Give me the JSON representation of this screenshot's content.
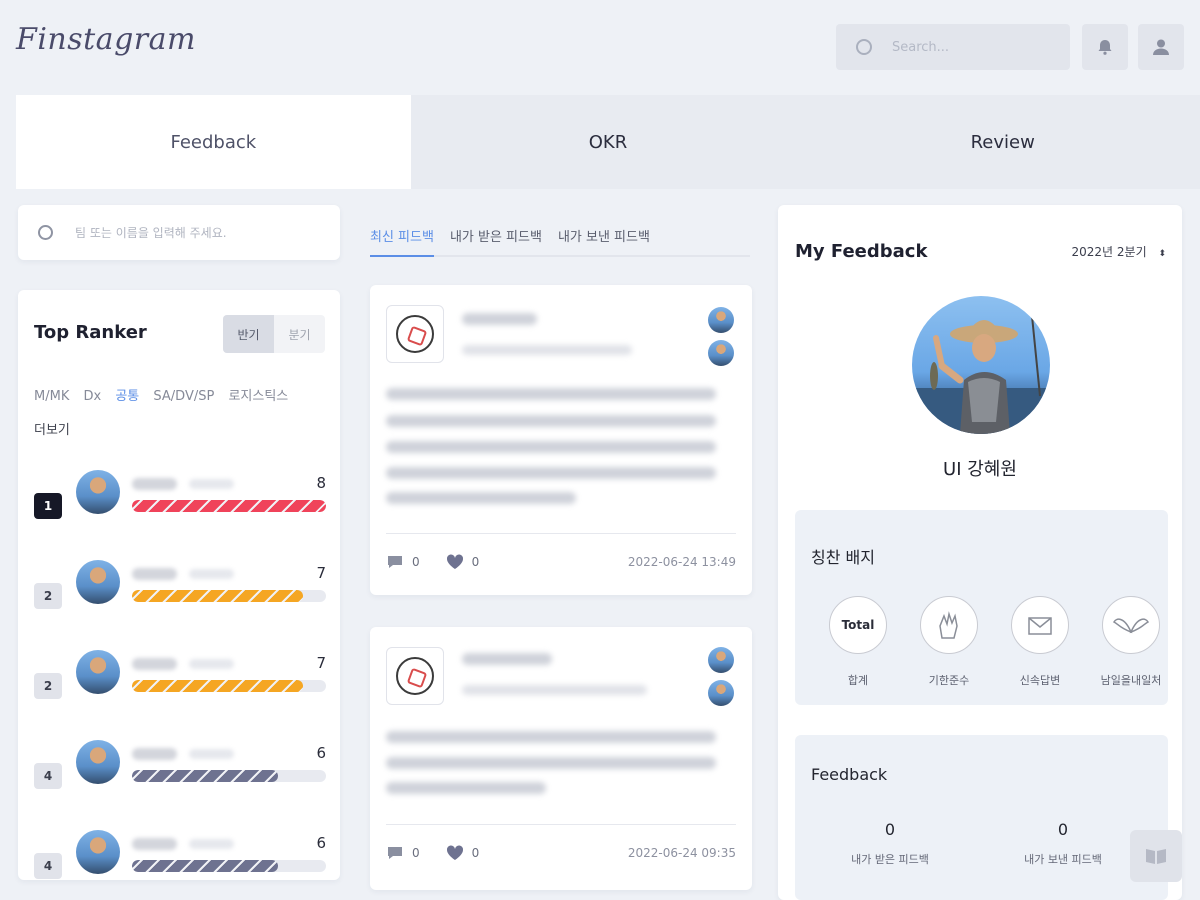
{
  "header": {
    "logo": "Finstagram",
    "search_placeholder": "Search..."
  },
  "tabs": [
    {
      "label": "Feedback",
      "active": true
    },
    {
      "label": "OKR",
      "active": false
    },
    {
      "label": "Review",
      "active": false
    }
  ],
  "left": {
    "search_placeholder": "팀 또는 이름을 입력해 주세요.",
    "ranker": {
      "title": "Top Ranker",
      "toggle": [
        "반기",
        "분기"
      ],
      "filters": [
        "M/MK",
        "Dx",
        "공통",
        "SA/DV/SP",
        "로지스틱스"
      ],
      "selected_filter": "공통",
      "more": "더보기",
      "rows": [
        {
          "rank": "1",
          "score": "8",
          "fill": 1.0,
          "color": "#f0435a"
        },
        {
          "rank": "2",
          "score": "7",
          "fill": 0.88,
          "color": "#f5a623"
        },
        {
          "rank": "2",
          "score": "7",
          "fill": 0.88,
          "color": "#f5a623"
        },
        {
          "rank": "4",
          "score": "6",
          "fill": 0.75,
          "color": "#6e7290"
        },
        {
          "rank": "4",
          "score": "6",
          "fill": 0.75,
          "color": "#6e7290"
        }
      ]
    }
  },
  "middle": {
    "subtabs": [
      {
        "label": "최신 피드백",
        "active": true
      },
      {
        "label": "내가 받은 피드백",
        "active": false
      },
      {
        "label": "내가 보낸 피드백",
        "active": false
      }
    ],
    "cards": [
      {
        "comments": "0",
        "likes": "0",
        "date": "2022-06-24 13:49"
      },
      {
        "comments": "0",
        "likes": "0",
        "date": "2022-06-24 09:35"
      }
    ]
  },
  "right": {
    "title": "My Feedback",
    "period": "2022년 2분기",
    "user_name": "UI 강혜원",
    "badges_title": "칭찬 배지",
    "badges": [
      {
        "icon": "Total",
        "label": "합계"
      },
      {
        "icon": "hand-icon",
        "label": "기한준수"
      },
      {
        "icon": "mail-icon",
        "label": "신속답변"
      },
      {
        "icon": "wings-icon",
        "label": "남일을내일처"
      }
    ],
    "feedback_title": "Feedback",
    "stats": [
      {
        "value": "0",
        "label": "내가 받은 피드백"
      },
      {
        "value": "0",
        "label": "내가 보낸 피드백"
      }
    ]
  }
}
